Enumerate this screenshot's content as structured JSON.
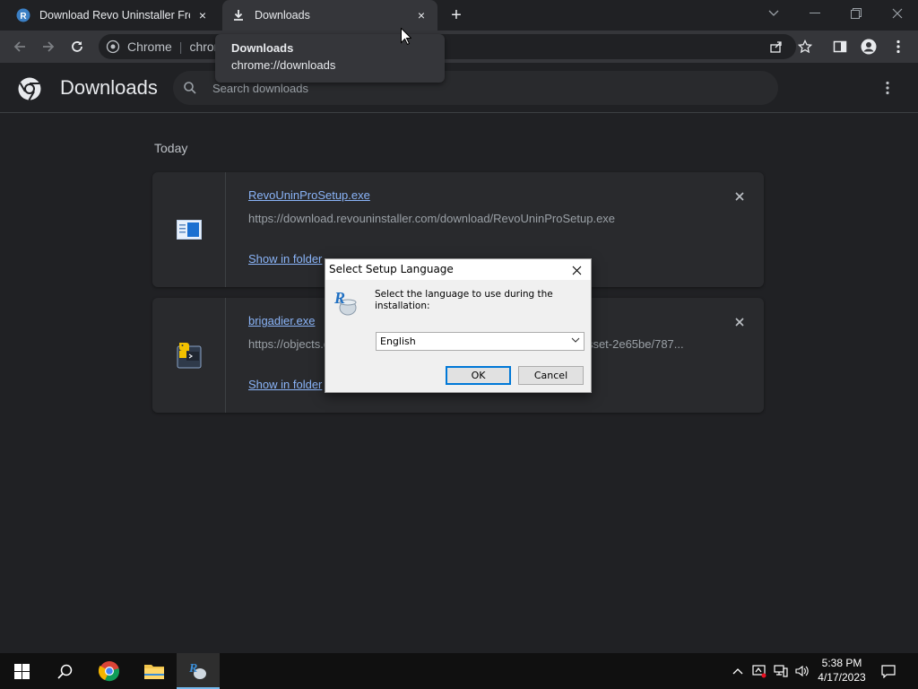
{
  "browser": {
    "tabs": [
      {
        "title": "Download Revo Uninstaller Freeware",
        "close": "×"
      },
      {
        "title": "Downloads",
        "close": "×"
      }
    ],
    "new_tab": "+",
    "omnibox": {
      "scheme_label": "Chrome",
      "url_text": "chrome://downloads"
    },
    "tooltip": {
      "title": "Downloads",
      "url": "chrome://downloads"
    }
  },
  "downloads_page": {
    "title": "Downloads",
    "search_placeholder": "Search downloads",
    "section": "Today",
    "items": [
      {
        "filename": "RevoUninProSetup.exe",
        "url": "https://download.revouninstaller.com/download/RevoUninProSetup.exe",
        "action": "Show in folder"
      },
      {
        "filename": "brigadier.exe",
        "url": "https://objects.githubusercontent.com/github-production-release-asset-2e65be/787...",
        "action": "Show in folder"
      }
    ]
  },
  "dialog": {
    "title": "Select Setup Language",
    "message": "Select the language to use during the installation:",
    "selected_language": "English",
    "ok_label": "OK",
    "cancel_label": "Cancel"
  },
  "taskbar": {
    "time": "5:38 PM",
    "date": "4/17/2023"
  },
  "colors": {
    "chrome_bg": "#202124",
    "toolbar_bg": "#35363a",
    "card_bg": "#292a2d",
    "link": "#8ab4f8",
    "dialog_focus": "#0078d7"
  }
}
